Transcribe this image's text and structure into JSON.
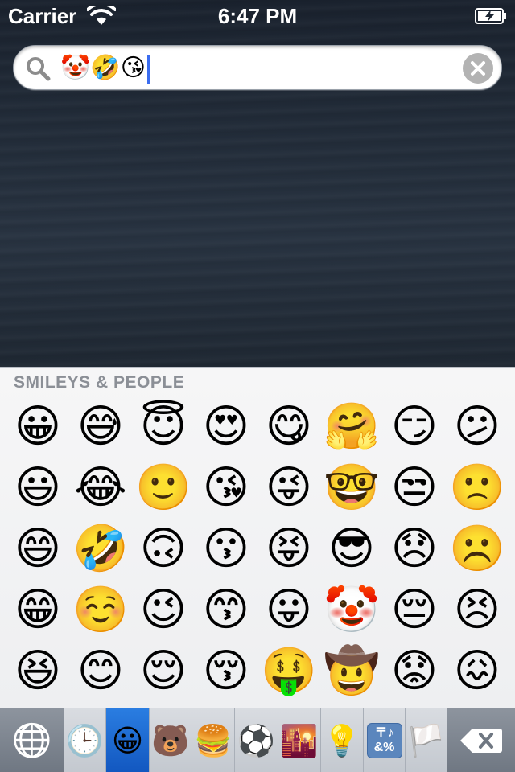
{
  "status_bar": {
    "carrier": "Carrier",
    "time": "6:47 PM",
    "icons": [
      "wifi-icon",
      "battery-charging-icon"
    ]
  },
  "search": {
    "value": "🤡🤣😘",
    "icon": "search-icon",
    "clear_icon": "clear-icon",
    "caret_color": "#3b6df0"
  },
  "keyboard": {
    "category_title": "SMILEYS & PEOPLE",
    "emoji": [
      "😀",
      "😅",
      "😇",
      "😍",
      "😋",
      "🤗",
      "😏",
      "😕",
      "😃",
      "😂",
      "🙂",
      "😘",
      "😜",
      "🤓",
      "😒",
      "🙁",
      "😄",
      "🤣",
      "🙃",
      "😗",
      "😝",
      "😎",
      "😞",
      "☹️",
      "😁",
      "☺️",
      "😉",
      "😙",
      "😛",
      "🤡",
      "😔",
      "😣",
      "😆",
      "😊",
      "😌",
      "😚",
      "🤑",
      "🤠",
      "😟",
      "😖"
    ],
    "tabs": [
      {
        "id": "globe",
        "icon": "globe-icon",
        "glyph": "🌐"
      },
      {
        "id": "recent",
        "icon": "clock-icon",
        "glyph": "🕒"
      },
      {
        "id": "smileys",
        "icon": "smiley-icon",
        "glyph": "😀",
        "selected": true
      },
      {
        "id": "animals",
        "icon": "bear-icon",
        "glyph": "🐻"
      },
      {
        "id": "food",
        "icon": "burger-icon",
        "glyph": "🍔"
      },
      {
        "id": "activity",
        "icon": "soccer-ball-icon",
        "glyph": "⚽"
      },
      {
        "id": "travel",
        "icon": "city-sunset-icon",
        "glyph": "🌇"
      },
      {
        "id": "objects",
        "icon": "light-bulb-icon",
        "glyph": "💡"
      },
      {
        "id": "symbols",
        "icon": "symbols-icon",
        "top": "〒♪",
        "bottom": "&%"
      },
      {
        "id": "flags",
        "icon": "flag-icon",
        "glyph": "🏳️"
      },
      {
        "id": "delete",
        "icon": "backspace-icon"
      }
    ],
    "accent_color": "#1f6fd6"
  }
}
